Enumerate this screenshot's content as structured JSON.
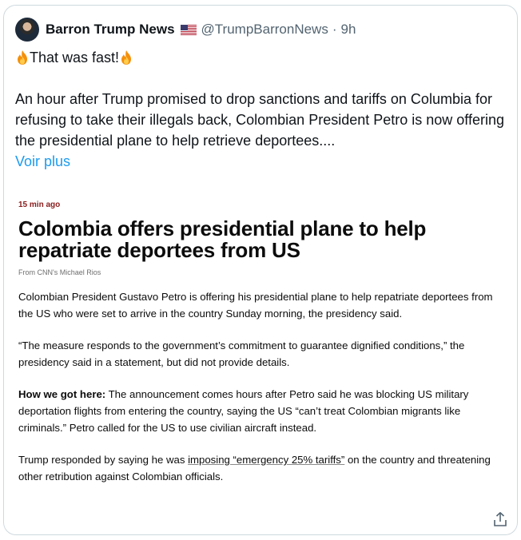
{
  "tweet": {
    "author_name": "Barron Trump News",
    "handle": "@TrumpBarronNews",
    "separator": "·",
    "time": "9h",
    "headline_text": "That was fast!",
    "body": "An hour after Trump promised to drop sanctions and tariffs on Columbia for refusing to take their illegals back, Colombian President Petro is now offering the presidential plane to help retrieve deportees....",
    "show_more": "Voir plus"
  },
  "article": {
    "timestamp": "15 min ago",
    "headline": "Colombia offers presidential plane to help repatriate deportees from US",
    "byline": "From CNN's Michael Rios",
    "p1": "Colombian President Gustavo Petro is offering his presidential plane to help repatriate deportees from the US who were set to arrive in the country Sunday morning, the presidency said.",
    "p2": "“The measure responds to the government’s commitment to guarantee dignified conditions,” the presidency said in a statement, but did not provide details.",
    "p3_lead": "How we got here:",
    "p3_rest": " The announcement comes hours after Petro said he was blocking US military deportation flights from entering the country, saying the US “can’t treat Colombian migrants like criminals.” Petro called for the US to use civilian aircraft instead.",
    "p4_before": "Trump responded by saying he was ",
    "p4_link": "imposing “emergency 25% tariffs”",
    "p4_after": " on the country and threatening other retribution against Colombian officials."
  },
  "colors": {
    "link": "#1d9bf0",
    "muted": "#536471",
    "text": "#0f1419",
    "border": "#cfd9de"
  },
  "icons": {
    "flag": "us-flag-icon",
    "fire": "fire-icon",
    "share": "share-icon"
  }
}
